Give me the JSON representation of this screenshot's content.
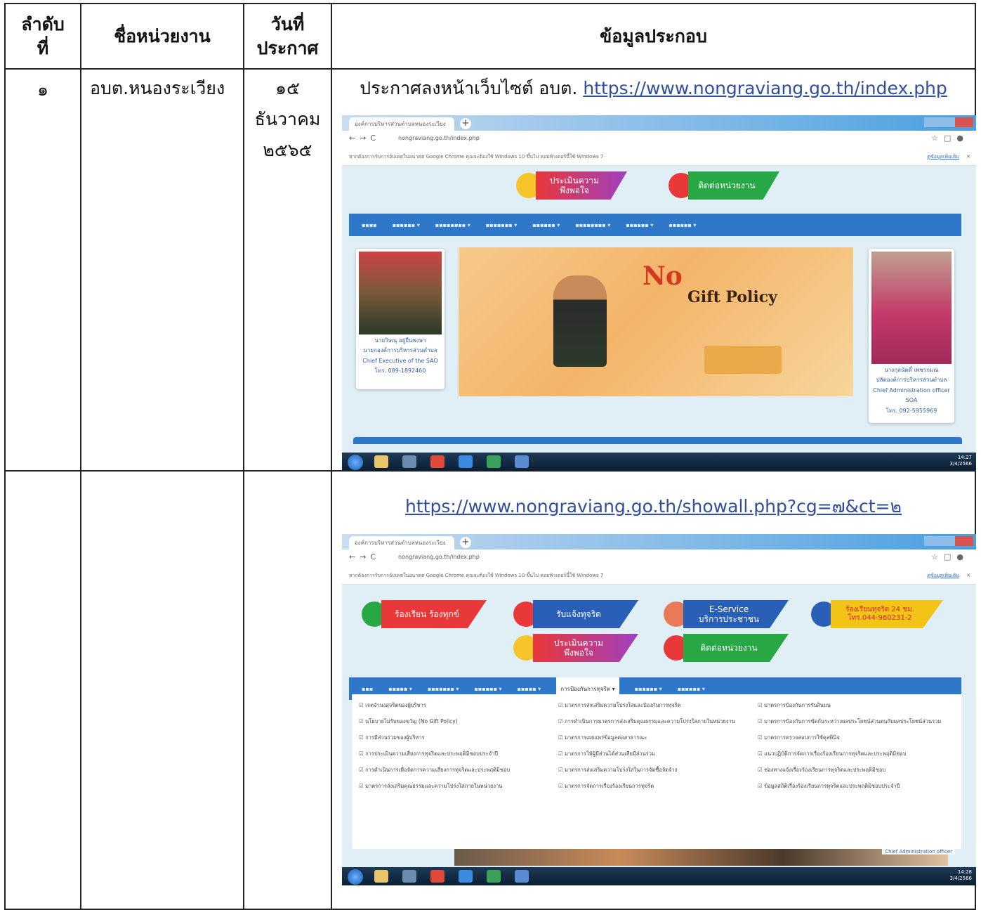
{
  "headers": {
    "no": "ลำดับ\nที่",
    "agency": "ชื่อหน่วยงาน",
    "date": "วันที่\nประกาศ",
    "info": "ข้อมูลประกอบ"
  },
  "row1": {
    "no": "๑",
    "agency": "อบต.หนองระเวียง",
    "date_day": "๑๕",
    "date_month": "ธันวาคม",
    "date_year": "๒๕๖๕",
    "info_prefix": "ประกาศลงหน้าเว็บไซต์ อบต.",
    "info_url": "https://www.nongraviang.go.th/index.php"
  },
  "row2": {
    "info_url": "https://www.nongraviang.go.th/showall.php?cg=๗&ct=๒"
  },
  "screenshot1": {
    "tab_title": "องค์การบริหารส่วนตำบลหนองระเวียง",
    "address": "nongraviang.go.th/index.php",
    "infobar": "หากต้องการรับการอัปเดตในอนาคต Google Chrome คุณจะต้องใช้ Windows 10 ขึ้นไป คอมพิวเตอร์นี้ใช้ Windows 7",
    "infobar_link": "ดูข้อมูลเพิ่มเติม",
    "btn_rate": "ประเมินความ\nพึงพอใจ",
    "btn_contact": "ติดต่อหน่วยงาน",
    "banner_no": "No",
    "banner_gift": "Gift Policy",
    "left_card": [
      "นายวิษณุ อยู่ยืนพงษา",
      "นายกองค์การบริหารส่วนตำบล",
      "Chief Executive of the SAO",
      "โทร. 089-1892460"
    ],
    "right_card": [
      "นางกุลนัดดิ์ เพชรกมณ",
      "ปลัดองค์การบริหารส่วนตำบล",
      "Chief Administration officer",
      "SOA",
      "โทร. 092-5955969"
    ],
    "clock": [
      "14:27",
      "3/4/2566"
    ]
  },
  "screenshot2": {
    "tab_title": "องค์การบริหารส่วนตำบลหนองระเวียง",
    "address": "nongraviang.go.th/index.php",
    "infobar": "หากต้องการรับการอัปเดตในอนาคต Google Chrome คุณจะต้องใช้ Windows 10 ขึ้นไป คอมพิวเตอร์นี้ใช้ Windows 7",
    "infobar_link": "ดูข้อมูลเพิ่มเติม",
    "btn_complaint": "ร้องเรียน ร้องทุกข์",
    "btn_corrupt": "รับแจ้งทุจริต",
    "btn_eservice": "E-Service\nบริการประชาชน",
    "btn_hotline": "ร้องเรียนทุจริต 24 ชม.\nโทร.044-960231-2",
    "btn_rate": "ประเมินความ\nพึงพอใจ",
    "btn_contact": "ติดต่อหน่วยงาน",
    "menu_active": "การป้องกันการทุจริต ▾",
    "links_col1": [
      "เจตจำนงสุจริตของผู้บริหาร",
      "นโยบายไม่รับของขวัญ (No Gift Policy)",
      "การมีส่วนร่วมของผู้บริหาร",
      "การประเมินความเสี่ยงการทุจริตและประพฤติมิชอบประจำปี",
      "การดำเนินการเพื่อจัดการความเสี่ยงการทุจริตและประพฤติมิชอบ",
      "มาตรการส่งเสริมคุณธรรมและความโปร่งใสภายในหน่วยงาน"
    ],
    "links_col2": [
      "มาตรการส่งเสริมความโปร่งใสและป้องกันการทุจริต",
      "การดำเนินการมาตรการส่งเสริมคุณธรรมและความโปร่งใสภายในหน่วยงาน",
      "มาตรการเผยแพร่ข้อมูลต่อสาธารณะ",
      "มาตรการให้ผู้มีส่วนได้ส่วนเสียมีส่วนร่วม",
      "มาตรการส่งเสริมความโปร่งใสในการจัดซื้อจัดจ้าง",
      "มาตรการจัดการเรื่องร้องเรียนการทุจริต"
    ],
    "links_col3": [
      "มาตรการป้องกันการรับสินบน",
      "มาตรการป้องกันการขัดกันระหว่างผลประโยชน์ส่วนตนกับผลประโยชน์ส่วนรวม",
      "มาตรการตรวจสอบการใช้ดุลพินิจ",
      "แนวปฏิบัติการจัดการเรื่องร้องเรียนการทุจริตและประพฤติมิชอบ",
      "ช่องทางแจ้งเรื่องร้องเรียนการทุจริตและประพฤติมิชอบ",
      "ข้อมูลสถิติเรื่องร้องเรียนการทุจริตและประพฤติมิชอบประจำปี"
    ],
    "footer_card": "Chief Administration officer",
    "clock": [
      "14:28",
      "3/4/2566"
    ]
  },
  "colors": {
    "url": "#2f4ea0",
    "menu": "#2f77c8",
    "red_btn": "#e8383a",
    "green_btn": "#28a745",
    "blue_btn": "#2a5fb8",
    "yellow_btn": "#f2c417"
  }
}
